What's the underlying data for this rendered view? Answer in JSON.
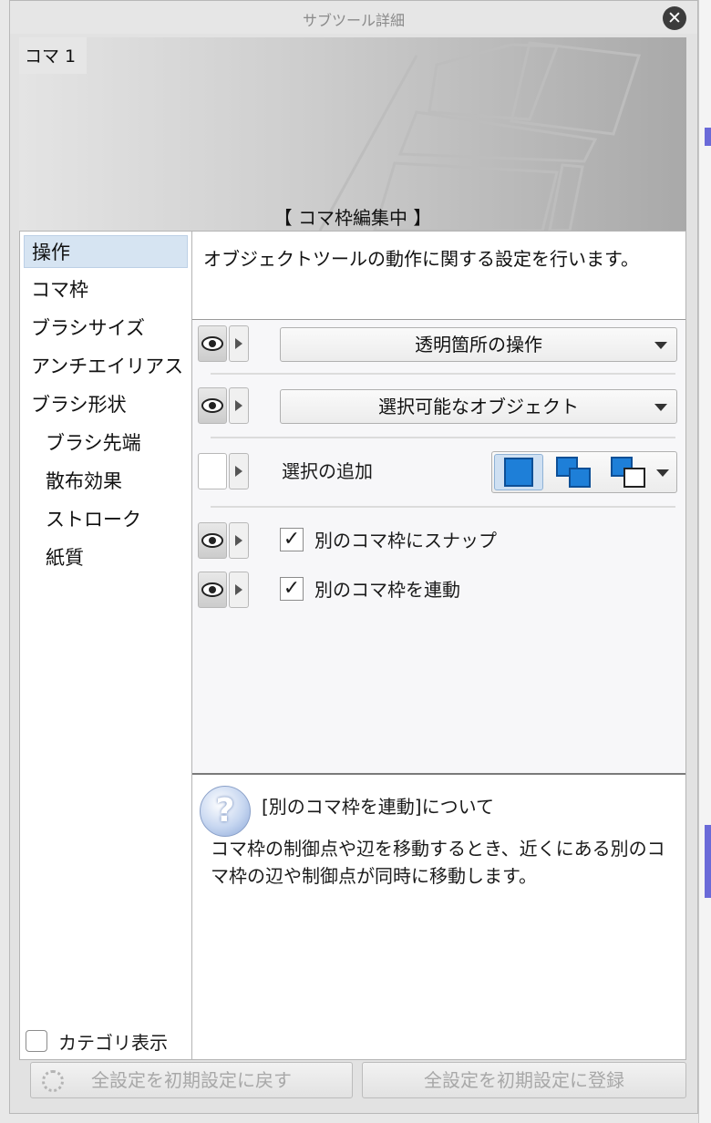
{
  "window": {
    "title": "サブツール詳細",
    "close_glyph": "✕"
  },
  "preview": {
    "label": "コマ 1",
    "status": "【 コマ枠編集中 】"
  },
  "sidebar": {
    "items": [
      {
        "label": "操作",
        "active": true
      },
      {
        "label": "コマ枠",
        "active": false
      },
      {
        "label": "ブラシサイズ",
        "active": false
      },
      {
        "label": "アンチエイリアス",
        "active": false
      },
      {
        "label": "ブラシ形状",
        "active": false
      },
      {
        "label": "ブラシ先端",
        "active": false
      },
      {
        "label": "散布効果",
        "active": false
      },
      {
        "label": "ストローク",
        "active": false
      },
      {
        "label": "紙質",
        "active": false
      }
    ],
    "category_label": "カテゴリ表示"
  },
  "main": {
    "description": "オブジェクトツールの動作に関する設定を行います。",
    "settings": {
      "transparent_op": "透明箇所の操作",
      "selectable_objects": "選択可能なオブジェクト",
      "add_selection_label": "選択の追加",
      "snap_label": "別のコマ枠にスナップ",
      "snap_checked": true,
      "link_label": "別のコマ枠を連動",
      "link_checked": true
    },
    "help": {
      "icon_glyph": "?",
      "title": "[別のコマ枠を連動]について",
      "body": "コマ枠の制御点や辺を移動するとき、近くにある別のコマ枠の辺や制御点が同時に移動します。"
    }
  },
  "footer": {
    "reset_all": "全設定を初期設定に戻す",
    "register_all": "全設定を初期設定に登録"
  },
  "icons": {
    "eye": "eye-icon",
    "expand": "triangle-right-icon",
    "mode_single": "square-icon",
    "mode_add": "add-selection-icon",
    "mode_toggle": "toggle-selection-icon",
    "check": "✓"
  },
  "colors": {
    "accent_blue": "#1e7fd8",
    "selected_row": "#d6e4f2"
  }
}
